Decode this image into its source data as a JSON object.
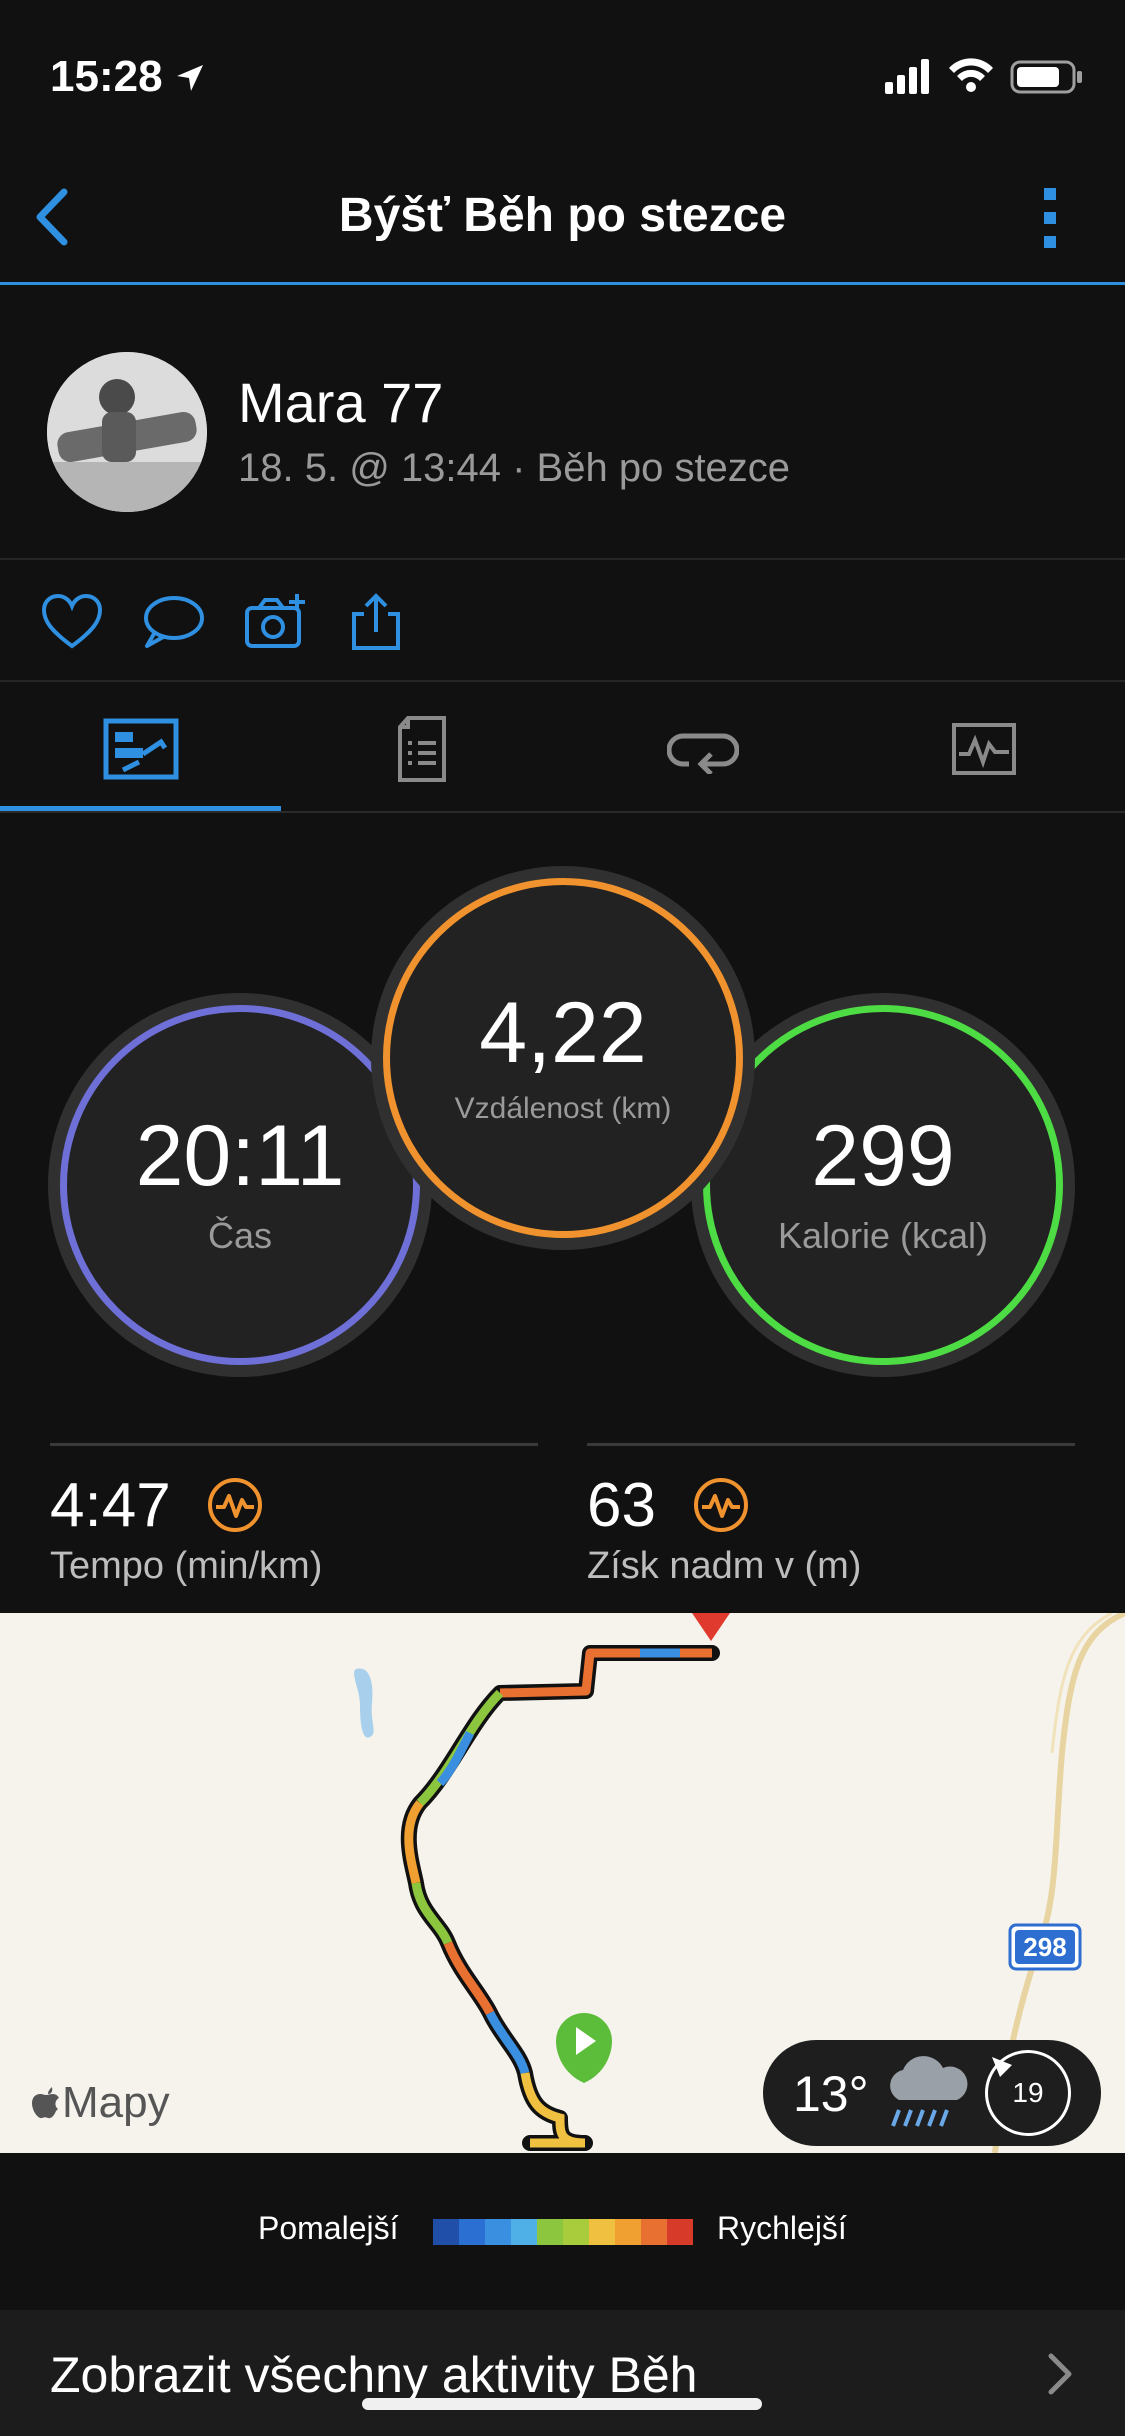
{
  "status_bar": {
    "time": "15:28"
  },
  "nav": {
    "title": "Býšť Běh po stezce"
  },
  "profile": {
    "name": "Mara 77",
    "subtitle": "18. 5. @ 13:44 · Běh po stezce"
  },
  "circles": {
    "time": {
      "value": "20:11",
      "label": "Čas"
    },
    "distance": {
      "value": "4,22",
      "label": "Vzdálenost (km)"
    },
    "calories": {
      "value": "299",
      "label": "Kalorie (kcal)"
    }
  },
  "stats": {
    "pace": {
      "value": "4:47",
      "label": "Tempo (min/km)"
    },
    "elevation": {
      "value": "63",
      "label": "Získ nadm v (m)"
    }
  },
  "map": {
    "attribution": "Mapy",
    "road_number": "298",
    "weather": {
      "temperature": "13°",
      "wind_speed": "19"
    }
  },
  "legend": {
    "slow_label": "Pomalejší",
    "fast_label": "Rychlejší",
    "colors": [
      "#1f4fa8",
      "#2a6fd1",
      "#3a8fe0",
      "#4fb0e8",
      "#8cc63f",
      "#a8cc3c",
      "#f0c040",
      "#f0a030",
      "#e87030",
      "#d83a2a"
    ]
  },
  "footer": {
    "more_link": "Zobrazit všechny aktivity Běh"
  },
  "colors": {
    "accent": "#2f8fe0",
    "time_ring": "#6f6fd8",
    "distance_ring": "#f0922e",
    "calories_ring": "#4ddc44",
    "stat_icon": "#f0922e"
  }
}
